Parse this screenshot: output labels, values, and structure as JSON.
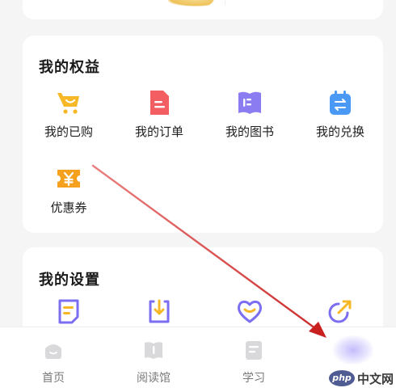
{
  "my_rights": {
    "title": "我的权益",
    "items": [
      {
        "label": "我的已购",
        "icon": "shopping-cart-icon"
      },
      {
        "label": "我的订单",
        "icon": "order-document-icon"
      },
      {
        "label": "我的图书",
        "icon": "book-icon"
      },
      {
        "label": "我的兑换",
        "icon": "exchange-calendar-icon"
      },
      {
        "label": "优惠券",
        "icon": "coupon-ticket-icon"
      }
    ]
  },
  "my_settings": {
    "title": "我的设置",
    "items": [
      {
        "icon": "note-document-icon"
      },
      {
        "icon": "download-icon"
      },
      {
        "icon": "heart-smile-icon"
      },
      {
        "icon": "share-arrow-icon"
      }
    ]
  },
  "bottom_nav": {
    "items": [
      {
        "label": "首页",
        "icon": "home-icon"
      },
      {
        "label": "阅读馆",
        "icon": "reading-hall-icon"
      },
      {
        "label": "学习",
        "icon": "study-notebook-icon"
      },
      {
        "label": "",
        "icon": "profile-icon"
      }
    ]
  },
  "watermark": {
    "logo": "php",
    "text": "中文网"
  },
  "colors": {
    "background": "#f5f5f6",
    "card": "#ffffff",
    "cart_yellow": "#f6b826",
    "order_red": "#f35e63",
    "book_purple": "#8b7cf2",
    "exchange_blue": "#4a9af5",
    "coupon_orange": "#f6a11e",
    "settings_purple": "#7b6ef0",
    "annotation_arrow": "#d42a2a"
  }
}
